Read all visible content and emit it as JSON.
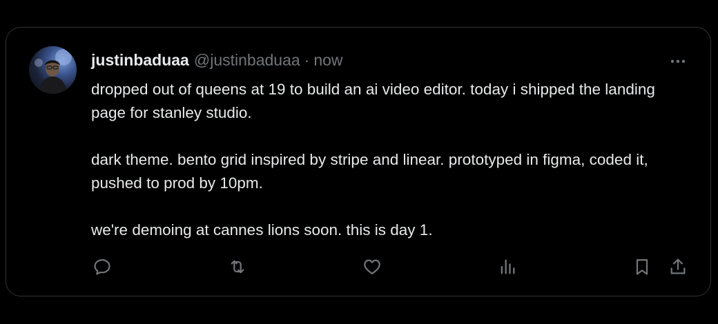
{
  "post": {
    "author": {
      "display_name": "justinbaduaa",
      "handle": "@justinbaduaa"
    },
    "separator": "·",
    "timestamp": "now",
    "paragraphs": [
      "dropped out of queens at 19 to build an ai video editor. today i shipped the landing page for stanley studio.",
      "dark theme. bento grid inspired by stripe and linear. prototyped in figma, coded it, pushed to prod by 10pm.",
      "we're demoing at cannes lions soon. this is day 1."
    ]
  },
  "actions": [
    "reply-icon",
    "repost-icon",
    "like-icon",
    "views-icon",
    "bookmark-icon",
    "share-icon"
  ],
  "colors": {
    "background": "#000000",
    "border": "#2f3336",
    "primary_text": "#e7e9ea",
    "secondary_text": "#71767b"
  }
}
